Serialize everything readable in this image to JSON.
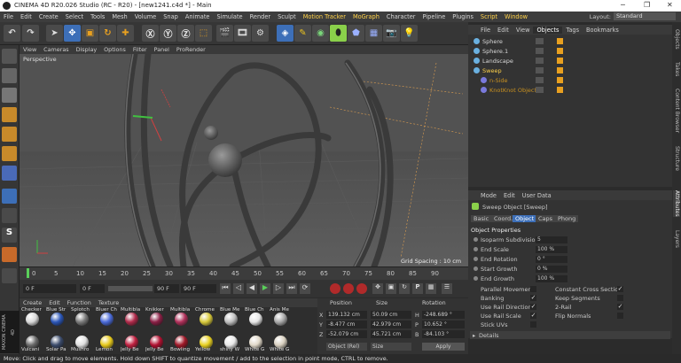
{
  "window": {
    "title": "CINEMA 4D R20.026 Studio (RC - R20) - [new1241.c4d *] - Main",
    "minimize": "─",
    "maximize": "❐",
    "close": "✕"
  },
  "menu": [
    "File",
    "Edit",
    "Create",
    "Select",
    "Tools",
    "Mesh",
    "Volume",
    "Snap",
    "Animate",
    "Simulate",
    "Render",
    "Sculpt",
    "Motion Tracker",
    "MoGraph",
    "Character",
    "Pipeline",
    "Plugins",
    "Script",
    "Window"
  ],
  "layout": {
    "label": "Layout:",
    "value": "Standard"
  },
  "viewport": {
    "menu": [
      "View",
      "Cameras",
      "Display",
      "Options",
      "Filter",
      "Panel",
      "ProRender"
    ],
    "camera": "Perspective",
    "grid_spacing": "Grid Spacing : 10 cm"
  },
  "timeline": {
    "ticks": [
      "0",
      "5",
      "10",
      "15",
      "20",
      "25",
      "30",
      "35",
      "40",
      "45",
      "50",
      "55",
      "60",
      "65",
      "70",
      "75",
      "80",
      "85",
      "90"
    ]
  },
  "time": {
    "current": "0 F",
    "start": "0 F",
    "end": "90 F",
    "end2": "90 F"
  },
  "materials": {
    "menu": [
      "Create",
      "Edit",
      "Function",
      "Texture"
    ],
    "items": [
      {
        "name": "Checker",
        "color": "#d8d8d8"
      },
      {
        "name": "Blue Str",
        "color": "#2b56b8"
      },
      {
        "name": "Splotch",
        "color": "#7a7a7a"
      },
      {
        "name": "Bluer Ch",
        "color": "#4a6ad8"
      },
      {
        "name": "Multibla",
        "color": "#b02a4a"
      },
      {
        "name": "Knikker",
        "color": "#8a1f45"
      },
      {
        "name": "Multibla",
        "color": "#b0305a"
      },
      {
        "name": "Chrome",
        "color": "#d8c93a"
      },
      {
        "name": "Blue Me",
        "color": "#bfbfbf"
      },
      {
        "name": "Blue Ch",
        "color": "#e6e6e6"
      },
      {
        "name": "Anis Me",
        "color": "#a8a8a8"
      }
    ],
    "row2": [
      {
        "name": "Vulcani",
        "color": "#6a6a6a"
      },
      {
        "name": "Solar Pa",
        "color": "#3a4a6a"
      },
      {
        "name": "Mushro",
        "color": "#e0e0e0"
      },
      {
        "name": "Lemon",
        "color": "#e6c81a"
      },
      {
        "name": "Jelly Be",
        "color": "#c02040"
      },
      {
        "name": "Jelly Be",
        "color": "#b01030"
      },
      {
        "name": "Bowling",
        "color": "#a01828"
      },
      {
        "name": "Yellow",
        "color": "#e8d020"
      },
      {
        "name": "shiny W",
        "color": "#e8e8e8"
      },
      {
        "name": "White G",
        "color": "#e0d8c8"
      },
      {
        "name": "White G",
        "color": "#d8d0c0"
      }
    ]
  },
  "coordinates": {
    "headers": [
      "Position",
      "Size",
      "Rotation"
    ],
    "rows": [
      {
        "axis": "X",
        "pos": "139.132 cm",
        "size": "50.09 cm",
        "raxis": "H",
        "rot": "-248.689 °"
      },
      {
        "axis": "Y",
        "pos": "-8.477 cm",
        "size": "42.979 cm",
        "raxis": "P",
        "rot": "10.652 °"
      },
      {
        "axis": "Z",
        "pos": "-52.079 cm",
        "size": "45.721 cm",
        "raxis": "B",
        "rot": "-84.103 °"
      }
    ],
    "mode": "Object (Rel)",
    "size_mode": "Size",
    "apply": "Apply"
  },
  "objects": {
    "tabs": [
      "File",
      "Edit",
      "View",
      "Objects",
      "Tags",
      "Bookmarks"
    ],
    "items": [
      {
        "name": "Sphere",
        "color": "#d8d8d8",
        "indent": 0
      },
      {
        "name": "Sphere.1",
        "color": "#d8d8d8",
        "indent": 0
      },
      {
        "name": "Landscape",
        "color": "#d8d8d8",
        "indent": 0
      },
      {
        "name": "Sweep",
        "color": "#ffd24a",
        "indent": 0
      },
      {
        "name": "n-Side",
        "color": "#c89020",
        "indent": 1
      },
      {
        "name": "KnotKnot Object",
        "color": "#c89020",
        "indent": 1
      }
    ]
  },
  "attributes": {
    "menu": [
      "Mode",
      "Edit",
      "User Data"
    ],
    "title": "Sweep Object [Sweep]",
    "tabs": [
      "Basic",
      "Coord.",
      "Object",
      "Caps",
      "Phong"
    ],
    "section": "Object Properties",
    "fields": [
      {
        "label": "Isoparm Subdivision",
        "value": "5"
      },
      {
        "label": "End Scale",
        "value": "100 %"
      },
      {
        "label": "End Rotation",
        "value": "0 °"
      },
      {
        "label": "Start Growth",
        "value": "0 %"
      },
      {
        "label": "End Growth",
        "value": "100 %"
      }
    ],
    "checks_left": [
      {
        "label": "Parallel Movement",
        "checked": ""
      },
      {
        "label": "Banking",
        "checked": "✓"
      },
      {
        "label": "Use Rail Direction",
        "checked": "✓"
      },
      {
        "label": "Use Rail Scale",
        "checked": "✓"
      },
      {
        "label": "Stick UVs",
        "checked": ""
      }
    ],
    "checks_right": [
      {
        "label": "Constant Cross Section",
        "checked": "✓"
      },
      {
        "label": "Keep Segments",
        "checked": ""
      },
      {
        "label": "2-Rail",
        "checked": "✓"
      },
      {
        "label": "Flip Normals",
        "checked": ""
      }
    ],
    "details": "Details"
  },
  "right_tabs": [
    "Objects",
    "Takes",
    "Content Browser",
    "Structure",
    "Attributes",
    "Layers"
  ],
  "brand": [
    "MAXON",
    "CINEMA 4D"
  ],
  "status": "Move: Click and drag to move elements. Hold down SHIFT to quantize movement / add to the selection in point mode, CTRL to remove."
}
